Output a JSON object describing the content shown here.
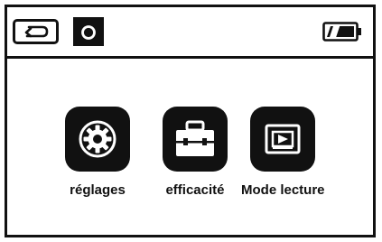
{
  "status_bar": {
    "back_icon": "back-arrow-icon",
    "camera_icon": "camera-icon",
    "battery_icon": "battery-icon",
    "battery_level": 0.66
  },
  "menu": {
    "items": [
      {
        "label": "réglages",
        "icon": "gear-icon"
      },
      {
        "label": "efficacité",
        "icon": "toolbox-icon"
      },
      {
        "label": "Mode lecture",
        "icon": "playback-icon"
      }
    ]
  },
  "colors": {
    "foreground": "#111111",
    "background": "#ffffff"
  }
}
